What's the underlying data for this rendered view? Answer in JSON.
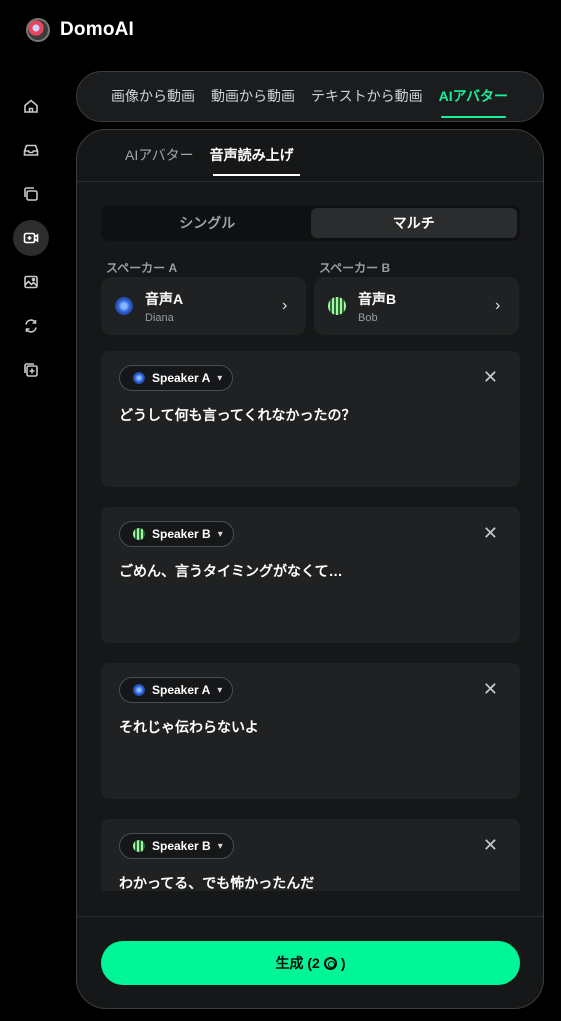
{
  "app": {
    "name": "DomoAI"
  },
  "sidebar": {
    "items": [
      {
        "icon": "home-icon"
      },
      {
        "icon": "inbox-icon"
      },
      {
        "icon": "layers-icon"
      },
      {
        "icon": "video-plus-icon",
        "active": true
      },
      {
        "icon": "image-icon"
      },
      {
        "icon": "refresh-icon"
      },
      {
        "icon": "add-media-icon"
      }
    ]
  },
  "mode_tabs": [
    {
      "label": "画像から動画"
    },
    {
      "label": "動画から動画"
    },
    {
      "label": "テキストから動画"
    },
    {
      "label": "AIアバター",
      "active": true
    }
  ],
  "sub_tabs": [
    {
      "label": "AIアバター"
    },
    {
      "label": "音声読み上げ",
      "active": true
    }
  ],
  "mode_toggle": {
    "single": "シングル",
    "multi": "マルチ",
    "selected": "マルチ"
  },
  "speakers": {
    "a": {
      "label": "スペーカー A",
      "name": "音声A",
      "voice": "Diana"
    },
    "b": {
      "label": "スペーカー B",
      "name": "音声B",
      "voice": "Bob"
    }
  },
  "lines": [
    {
      "speaker": "Speaker A",
      "text": "どうして何も言ってくれなかったの？"
    },
    {
      "speaker": "Speaker B",
      "text": "ごめん、言うタイミングがなくて…"
    },
    {
      "speaker": "Speaker A",
      "text": "それじゃ伝わらないよ"
    },
    {
      "speaker": "Speaker B",
      "text": "わかってる、でも怖かったんだ"
    }
  ],
  "generate": {
    "label": "生成 (2",
    "label_end": ")",
    "cost_icon": "coin-icon"
  },
  "colors": {
    "accent": "#00f596",
    "tab_accent": "#19f09a"
  }
}
